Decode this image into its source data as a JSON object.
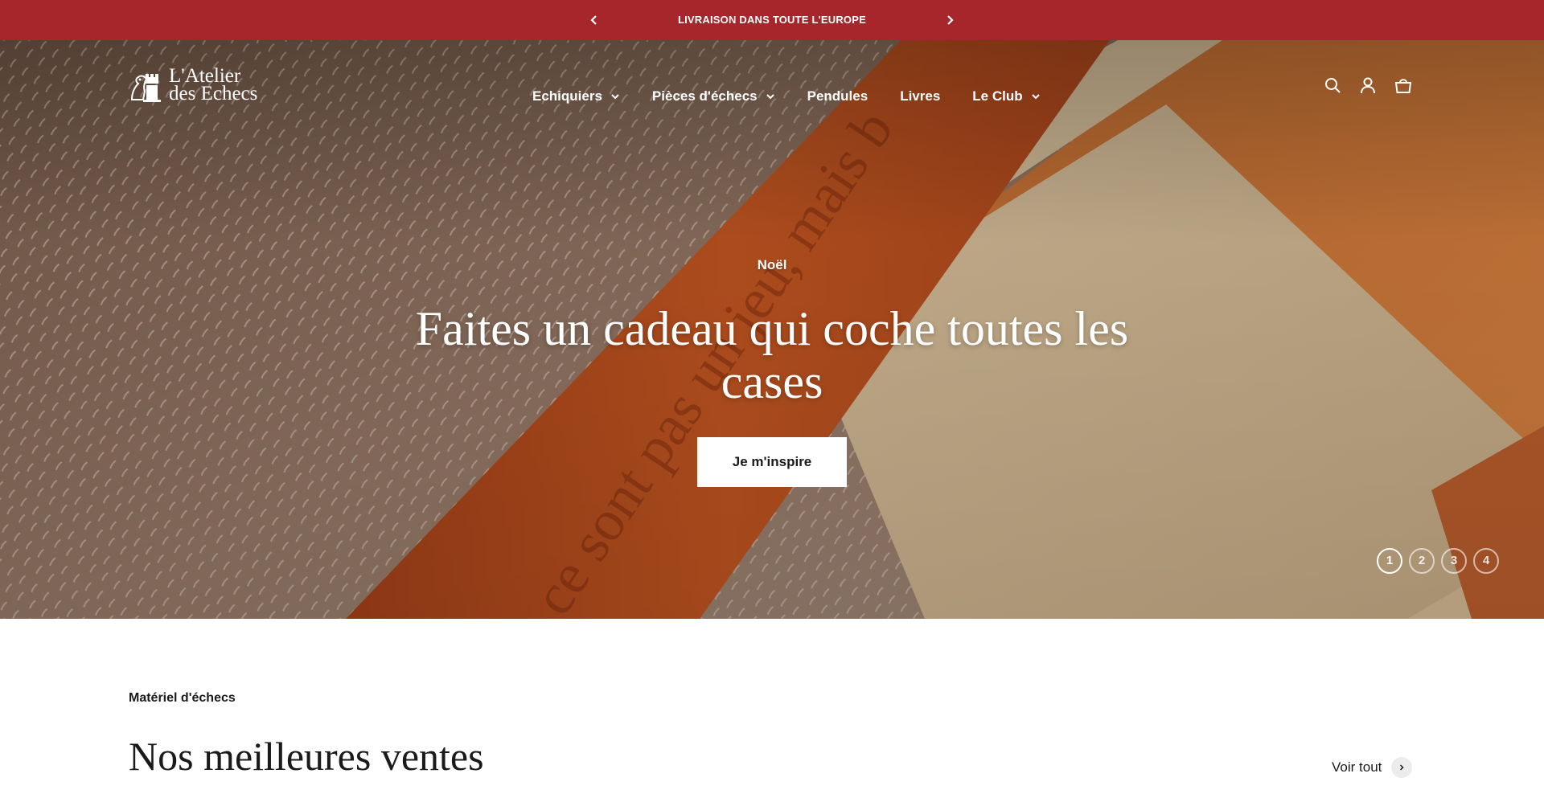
{
  "announcement": {
    "message": "LIVRAISON DANS TOUTE L'EUROPE",
    "prev_icon": "chevron-left-icon",
    "next_icon": "chevron-right-icon",
    "background": "#a6262b"
  },
  "logo": {
    "line1": "L'Atelier",
    "line2": "des Echecs",
    "icon": "chess-knight-rook-icon"
  },
  "nav": {
    "items": [
      {
        "label": "Echiquiers",
        "has_dropdown": true
      },
      {
        "label": "Pièces d'échecs",
        "has_dropdown": true
      },
      {
        "label": "Pendules",
        "has_dropdown": false
      },
      {
        "label": "Livres",
        "has_dropdown": false
      },
      {
        "label": "Le Club",
        "has_dropdown": true
      }
    ]
  },
  "header_icons": [
    "search-icon",
    "account-icon",
    "cart-icon"
  ],
  "hero": {
    "subheading": "Noël",
    "title": "Faites un cadeau qui coche toutes les cases",
    "button_label": "Je m'inspire",
    "slides": [
      "1",
      "2",
      "3",
      "4"
    ],
    "active_slide": "1"
  },
  "best_sellers": {
    "kicker": "Matériel d'échecs",
    "title": "Nos meilleures ventes",
    "see_all_label": "Voir tout"
  }
}
